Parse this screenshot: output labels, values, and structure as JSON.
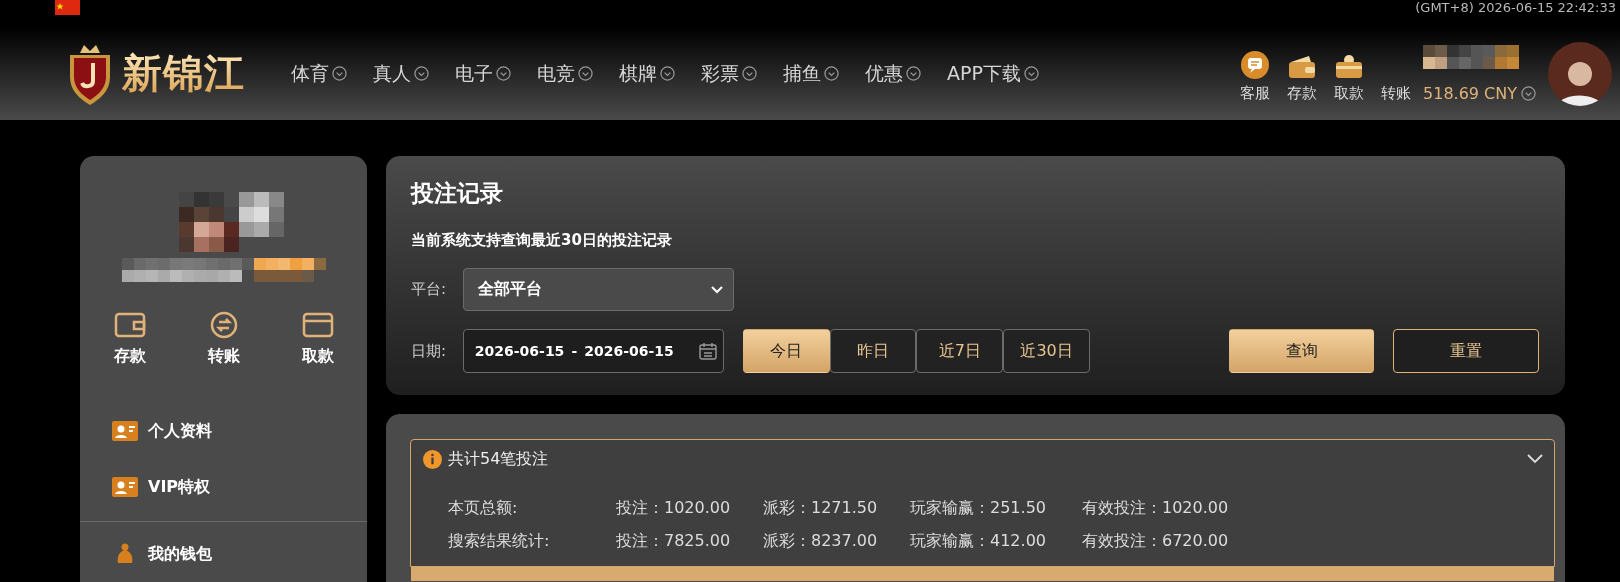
{
  "top_bar": {
    "time": "(GMT+8) 2026-06-15 22:42:33"
  },
  "header": {
    "logo": "新锦江",
    "nav": [
      {
        "label": "体育"
      },
      {
        "label": "真人"
      },
      {
        "label": "电子"
      },
      {
        "label": "电竞"
      },
      {
        "label": "棋牌"
      },
      {
        "label": "彩票"
      },
      {
        "label": "捕鱼"
      },
      {
        "label": "优惠"
      },
      {
        "label": "APP下载"
      }
    ],
    "actions": [
      {
        "label": "客服",
        "kind": "chat"
      },
      {
        "label": "存款",
        "kind": "wallet"
      },
      {
        "label": "取款",
        "kind": "card"
      },
      {
        "label": "转账",
        "kind": "none"
      }
    ],
    "balance": "518.69 CNY"
  },
  "sidebar": {
    "quick_actions": [
      {
        "label": "存款",
        "kind": "deposit"
      },
      {
        "label": "转账",
        "kind": "transfer"
      },
      {
        "label": "取款",
        "kind": "withdraw"
      }
    ],
    "menu": [
      {
        "label": "个人资料"
      },
      {
        "label": "VIP特权"
      }
    ],
    "section": "我的钱包"
  },
  "filter": {
    "title": "投注记录",
    "subtitle": "当前系统支持查询最近30日的投注记录",
    "platform_label": "平台:",
    "platform_value": "全部平台",
    "date_label": "日期:",
    "date_start": "2026-06-15",
    "date_separator": "-",
    "date_end": "2026-06-15",
    "ranges": [
      {
        "label": "今日",
        "selected": true
      },
      {
        "label": "昨日",
        "selected": false
      },
      {
        "label": "近7日",
        "selected": false
      },
      {
        "label": "近30日",
        "selected": false
      }
    ],
    "buttons": [
      {
        "label": "查询",
        "kind": "primary"
      },
      {
        "label": "重置",
        "kind": "secondary"
      }
    ]
  },
  "summary": {
    "title": "共计54笔投注",
    "expanded": true,
    "rows": [
      {
        "label": "本页总额:",
        "cells": [
          "投注：1020.00",
          "派彩：1271.50",
          "玩家输赢：251.50",
          "有效投注：1020.00"
        ]
      },
      {
        "label": "搜索结果统计:",
        "cells": [
          "投注：7825.00",
          "派彩：8237.00",
          "玩家输赢：412.00",
          "有效投注：6720.00"
        ]
      }
    ]
  }
}
